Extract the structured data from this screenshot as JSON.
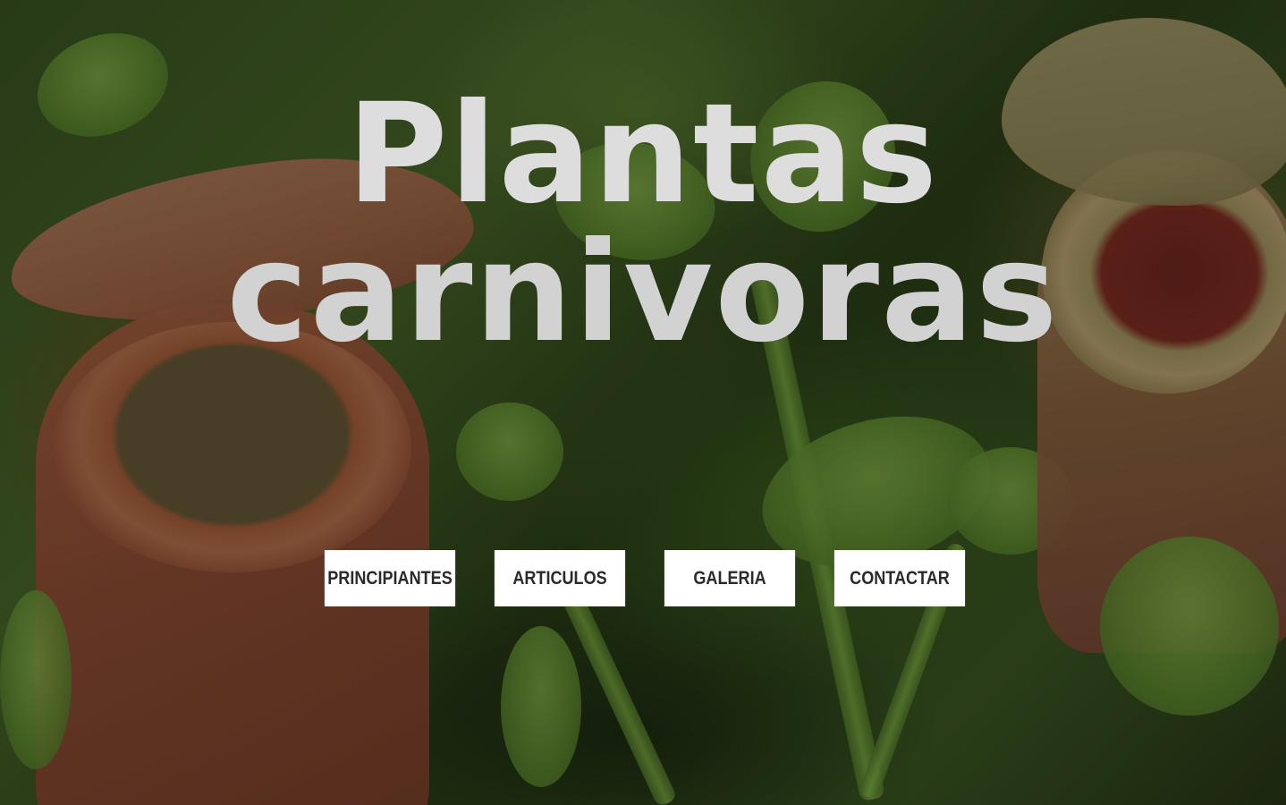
{
  "hero": {
    "title_line1": "Plantas",
    "title_line2": "carnivoras",
    "background_image": "carnivorous-plants-photo"
  },
  "nav": {
    "items": [
      {
        "label": "PRINCIPIANTES"
      },
      {
        "label": "ARTICULOS"
      },
      {
        "label": "GALERIA"
      },
      {
        "label": "CONTACTAR"
      }
    ]
  },
  "colors": {
    "title_text": "#dddddd",
    "button_bg": "#ffffff",
    "button_text": "#2b2b2b"
  }
}
